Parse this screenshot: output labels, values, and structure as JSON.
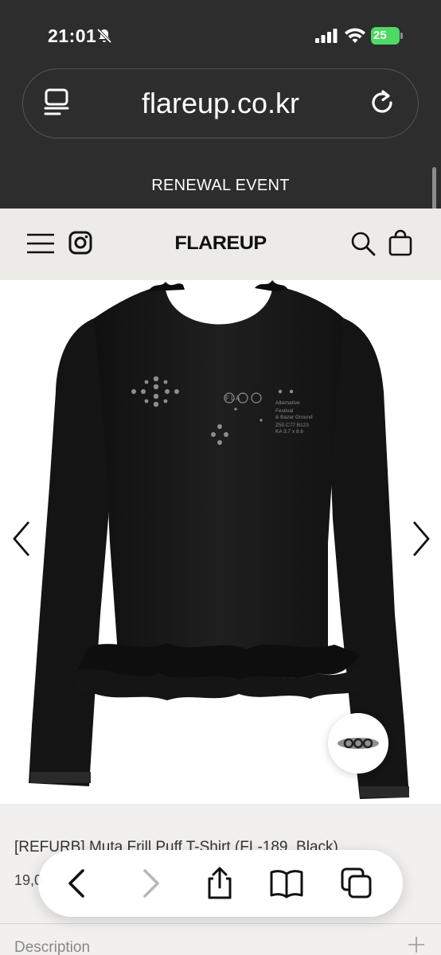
{
  "status_bar": {
    "time": "21:01",
    "battery": "25"
  },
  "browser": {
    "url": "flareup.co.kr"
  },
  "banner": {
    "text": "RENEWAL EVENT"
  },
  "site_header": {
    "logo": "FLAREUP"
  },
  "product": {
    "title": "[REFURB] Muta Frill Puff T-Shirt (FL-189_Black)",
    "price": "19,0",
    "shirt_print": {
      "line1": "Alternative",
      "line2": "Festival",
      "line3": "& Bazar Ground",
      "line4": "Z50 C77 B123",
      "line5": "KA 3.7 x 8.6"
    },
    "logo_mark": "F L A"
  },
  "info": {
    "description_label": "Description"
  },
  "colors": {
    "browser_chrome": "#2d2d2d",
    "header_bg": "#ecebe7",
    "battery_green": "#4cd964"
  },
  "icons": {
    "bell": "bell-slash-icon",
    "reader": "reader-mode-icon",
    "reload": "reload-icon",
    "menu": "hamburger-menu-icon",
    "instagram": "instagram-icon",
    "search": "search-icon",
    "bag": "shopping-bag-icon"
  }
}
